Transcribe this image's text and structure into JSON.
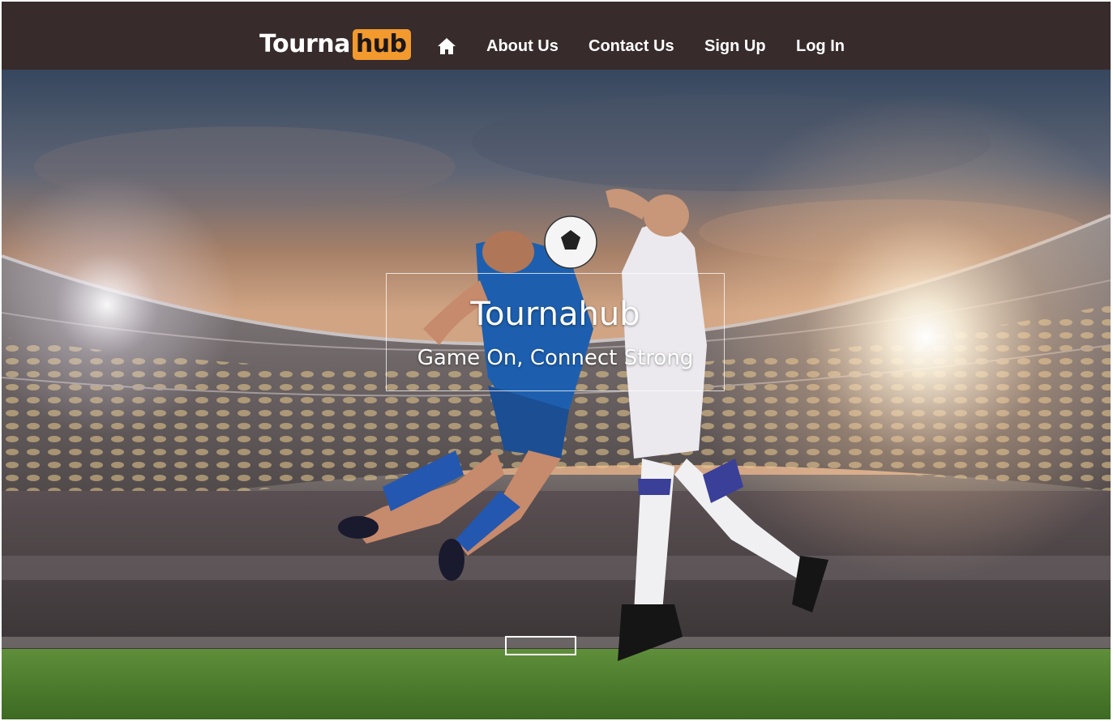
{
  "nav": {
    "brand": {
      "left": "Tourna",
      "right": "hub"
    },
    "home_icon": "home-icon",
    "links": [
      "About Us",
      "Contact Us",
      "Sign Up",
      "Log In"
    ]
  },
  "hero": {
    "title": "Tournahub",
    "subtitle": "Game On, Connect Strong",
    "background_image": "stadium-football-players-photo"
  },
  "colors": {
    "navbar_bg": "#372b2b",
    "brand_accent": "#f29a2e",
    "text_light": "#ffffff"
  }
}
